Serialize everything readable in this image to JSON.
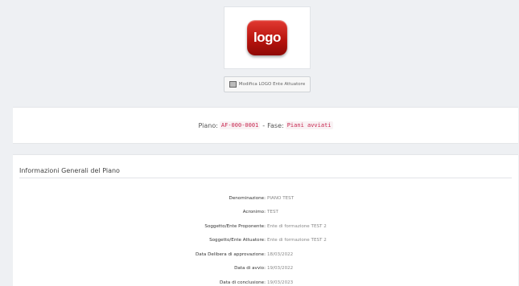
{
  "logo": {
    "text": "logo",
    "icon": "logo-image"
  },
  "edit_logo": {
    "label": "Modifica LOGO Ente Attuatore",
    "icon": "image-icon"
  },
  "plan": {
    "prefix": "Piano:",
    "code": "AF-000-0001",
    "separator": "-",
    "phase_label": "Fase:",
    "phase_value": "Piani avviati"
  },
  "info": {
    "title": "Informazioni Generali del Piano",
    "rows": [
      {
        "label": "Denominazione:",
        "value": "PIANO TEST"
      },
      {
        "label": "Acronimo:",
        "value": "TEST"
      },
      {
        "label": "Soggetto/Ente Proponente:",
        "value": "Ente di formazione TEST 2"
      },
      {
        "label": "Soggetto/Ente Attuatore:",
        "value": "Ente di formazione TEST 2"
      },
      {
        "label": "Data Delibera di approvazione:",
        "value": "18/03/2022"
      },
      {
        "label": "Data di avvio:",
        "value": "19/03/2022"
      },
      {
        "label": "Data di conclusione:",
        "value": "19/03/2023"
      }
    ]
  },
  "colors": {
    "background": "#eef0f3",
    "card": "#ffffff",
    "code_text": "#c7254e",
    "logo_red": "#c8170f"
  }
}
